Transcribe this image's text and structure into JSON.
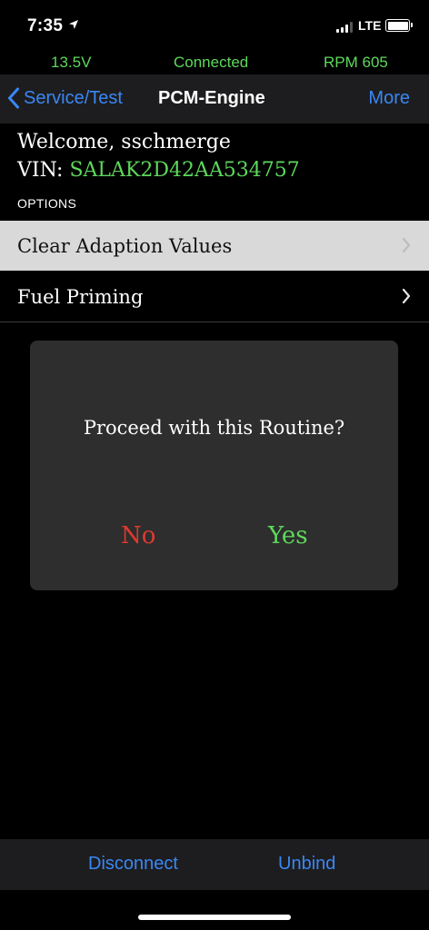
{
  "status_bar": {
    "time": "7:35",
    "network": "LTE",
    "icons": [
      "location-arrow-icon",
      "signal-icon",
      "battery-icon"
    ]
  },
  "info_bar": {
    "voltage": "13.5V",
    "connection": "Connected",
    "rpm": "RPM 605"
  },
  "nav": {
    "back_label": "Service/Test",
    "title": "PCM-Engine",
    "more_label": "More",
    "back_icon": "chevron-left-icon"
  },
  "header": {
    "welcome": "Welcome, sschmerge",
    "vin_label": "VIN:",
    "vin_value": "SALAK2D42AA534757",
    "options_label": "OPTIONS"
  },
  "options": [
    {
      "label": "Clear Adaption Values",
      "icon": "chevron-right-icon"
    },
    {
      "label": "Fuel Priming",
      "icon": "chevron-right-icon"
    }
  ],
  "dialog": {
    "message": "Proceed with this Routine?",
    "no_label": "No",
    "yes_label": "Yes"
  },
  "bottom_bar": {
    "disconnect_label": "Disconnect",
    "unbind_label": "Unbind"
  },
  "colors": {
    "accent_blue": "#3a87f5",
    "status_green": "#5dd85b",
    "danger_red": "#e0392f",
    "highlight_row": "#d9d9d9",
    "dialog_bg": "#2e2e2e"
  }
}
